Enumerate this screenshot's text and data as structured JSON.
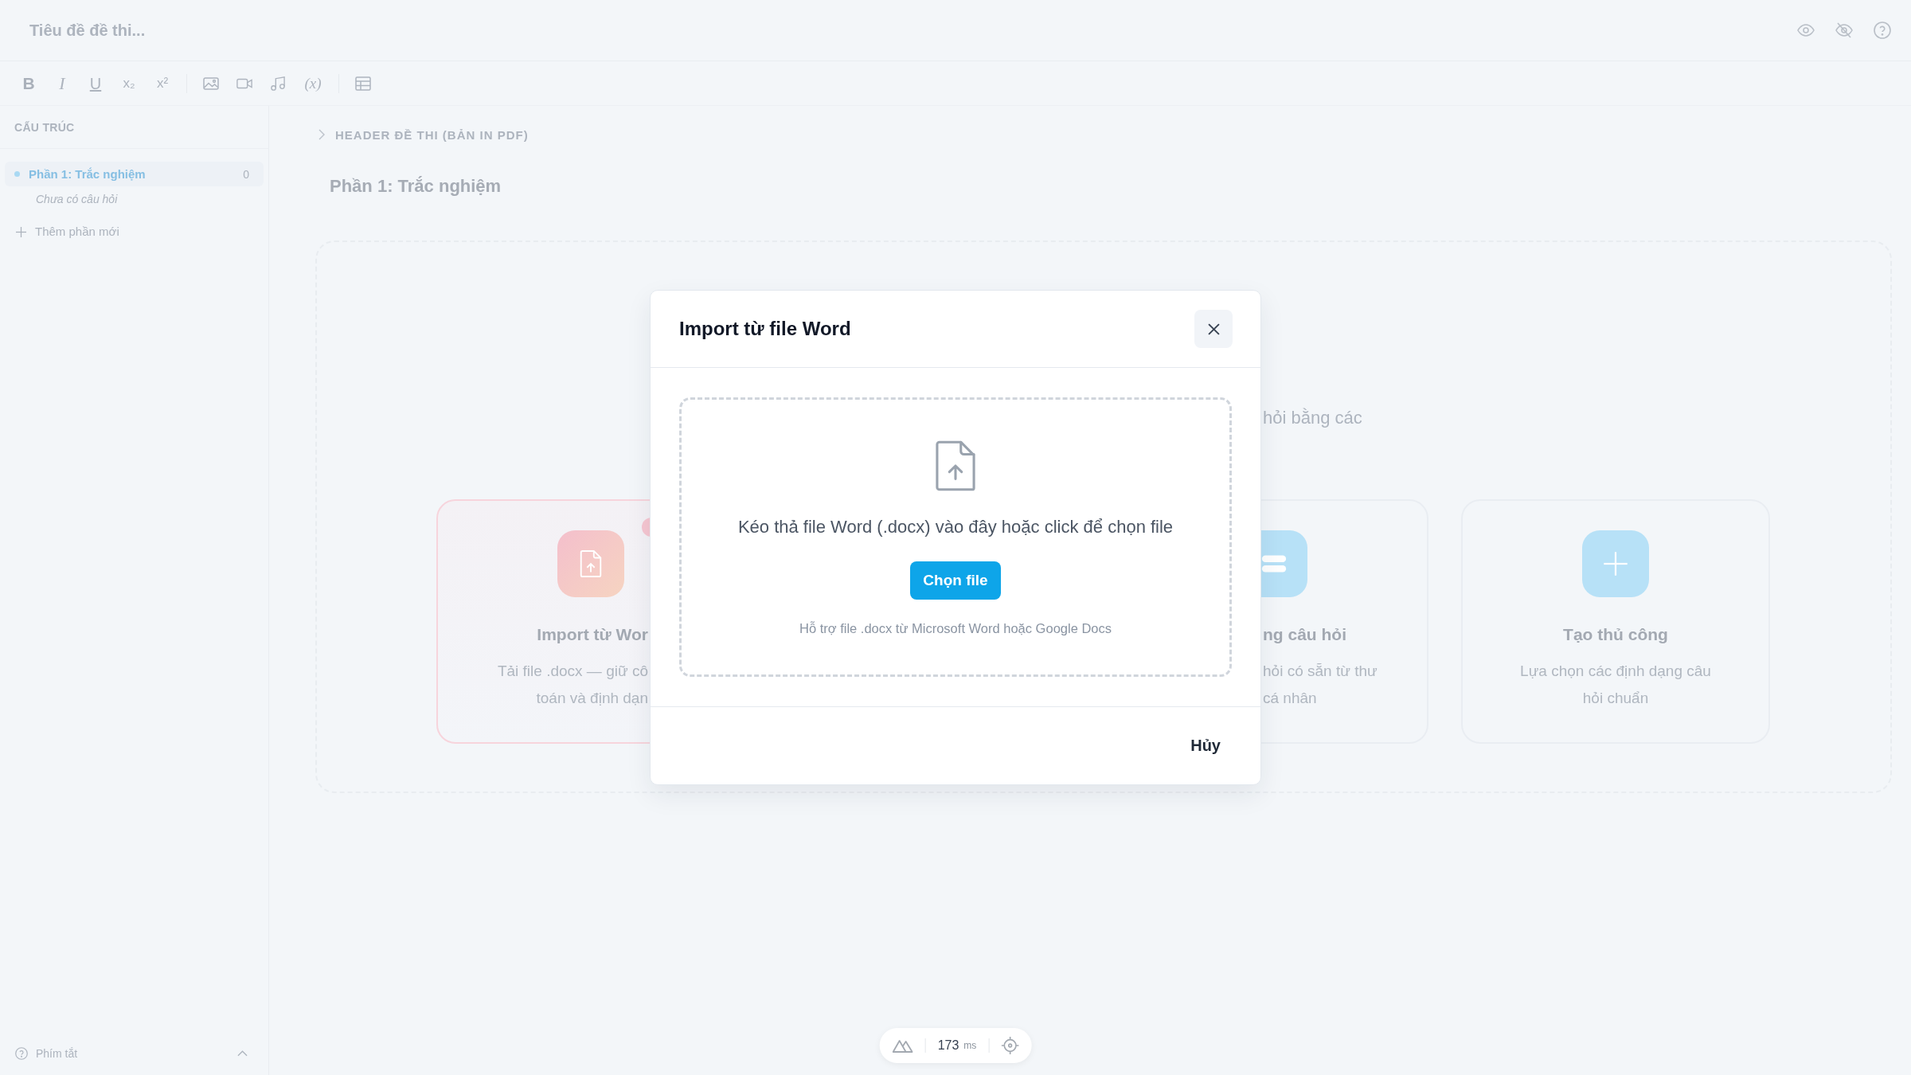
{
  "topbar": {
    "title_field": {
      "placeholder": "Tiêu đề đề thi..."
    },
    "actions": [
      {
        "kind": "preview"
      },
      {
        "kind": "hide"
      },
      {
        "kind": "help"
      }
    ]
  },
  "toolbar": {
    "groups": [
      {
        "items": [
          {
            "kind": "bold",
            "label": "B"
          },
          {
            "kind": "italic",
            "label": "I"
          },
          {
            "kind": "underline",
            "label": "U"
          },
          {
            "kind": "subscript",
            "label": "x₂"
          },
          {
            "kind": "superscript",
            "label": "x²"
          }
        ]
      },
      {
        "items": [
          {
            "kind": "image"
          },
          {
            "kind": "video"
          },
          {
            "kind": "audio"
          },
          {
            "kind": "formula",
            "label": "(x)"
          }
        ]
      },
      {
        "items": [
          {
            "kind": "table"
          }
        ]
      }
    ]
  },
  "sidebar": {
    "heading": "CẤU TRÚC",
    "sections": [
      {
        "title": "Phần 1: Trắc nghiệm",
        "count": "0",
        "selected": true,
        "note": "Chưa có câu hỏi"
      }
    ],
    "add_label": "Thêm phần mới",
    "footer_label": "Phím tắt"
  },
  "main": {
    "print_header": {
      "label": "HEADER ĐỀ THI (BẢN IN PDF)",
      "expanded": false
    },
    "section_title": "Phần 1: Trắc nghiệm",
    "empty_state": {
      "subtitle": "hỏi bằng các",
      "cards": [
        {
          "kind": "import",
          "title": "Import từ Wor",
          "description": [
            "Tải file .docx — giữ cô",
            "toán và định dạn"
          ],
          "selected": true,
          "badge": true
        },
        {
          "kind": "bank",
          "title": "ng câu hỏi",
          "description": [
            "hỏi có sẵn từ thư",
            "cá nhân"
          ],
          "selected": false,
          "badge": false
        },
        {
          "kind": "manual",
          "title": "Tạo thủ công",
          "description": [
            "Lựa chọn các định dạng câu",
            "hỏi chuẩn"
          ],
          "selected": false,
          "badge": false
        }
      ]
    }
  },
  "modal": {
    "title": "Import từ file Word",
    "dropzone": {
      "instructions": "Kéo thả file Word (.docx) vào đây hoặc click để chọn file",
      "button": "Chọn file",
      "hint": "Hỗ trợ file .docx từ Microsoft Word hoặc Google Docs"
    },
    "footer_buttons": [
      "Hủy"
    ]
  },
  "devtools": {
    "value": "173",
    "unit": "ms"
  }
}
